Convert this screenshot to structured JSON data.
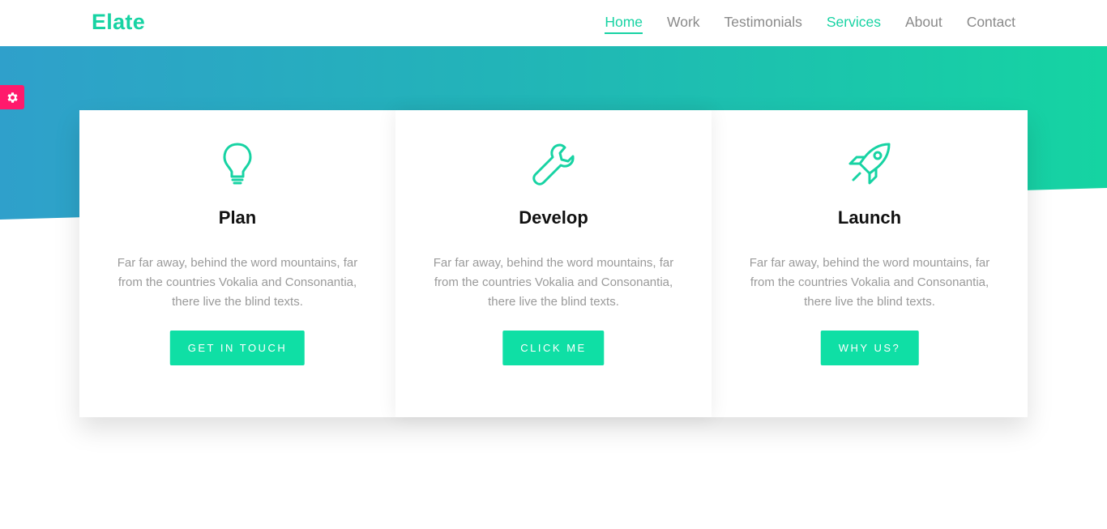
{
  "brand": "Elate",
  "nav": [
    {
      "label": "Home",
      "name": "nav-home"
    },
    {
      "label": "Work",
      "name": "nav-work"
    },
    {
      "label": "Testimonials",
      "name": "nav-testimonials"
    },
    {
      "label": "Services",
      "name": "nav-services"
    },
    {
      "label": "About",
      "name": "nav-about"
    },
    {
      "label": "Contact",
      "name": "nav-contact"
    }
  ],
  "settings": {
    "icon": "gear-icon",
    "color": "#ff1a6c"
  },
  "colors": {
    "accent": "#17d3a3",
    "button": "#0fdfa5",
    "hero_from": "#2fa4c9",
    "hero_to": "#17d3a3"
  },
  "cards": [
    {
      "icon": "lightbulb-icon",
      "title": "Plan",
      "text": "Far far away, behind the word mountains, far from the countries Vokalia and Consonantia, there live the blind texts.",
      "button": "GET IN TOUCH"
    },
    {
      "icon": "wrench-icon",
      "title": "Develop",
      "text": "Far far away, behind the word mountains, far from the countries Vokalia and Consonantia, there live the blind texts.",
      "button": "CLICK ME"
    },
    {
      "icon": "rocket-icon",
      "title": "Launch",
      "text": "Far far away, behind the word mountains, far from the countries Vokalia and Consonantia, there live the blind texts.",
      "button": "WHY US?"
    }
  ]
}
